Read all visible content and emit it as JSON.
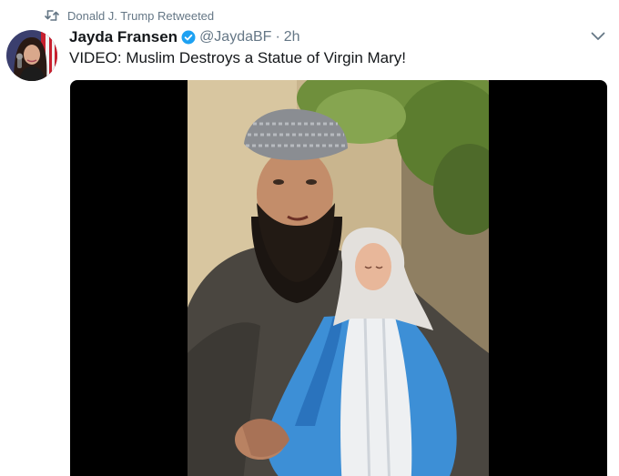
{
  "retweet_context": {
    "icon": "retweet-icon",
    "text": "Donald J. Trump Retweeted"
  },
  "author": {
    "display_name": "Jayda Fransen",
    "verified_icon": "verified-badge-icon",
    "handle": "@JaydaBF",
    "separator": "·",
    "time": "2h"
  },
  "tweet": {
    "text": "VIDEO: Muslim Destroys a Statue of Virgin Mary!"
  },
  "menu": {
    "icon": "chevron-down-icon"
  },
  "media": {
    "type": "video"
  },
  "colors": {
    "text_primary": "#14171a",
    "text_secondary": "#657786",
    "verified_blue": "#1da1f2",
    "media_background": "#000000"
  }
}
